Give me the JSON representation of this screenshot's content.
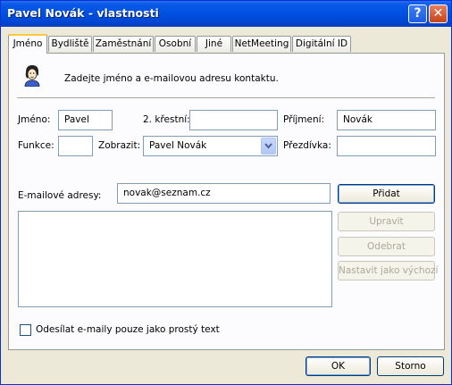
{
  "window": {
    "title": "Pavel Novák - vlastnosti",
    "help_icon": "?",
    "close_icon": "✕"
  },
  "tabs": [
    {
      "label": "Jméno",
      "active": true
    },
    {
      "label": "Bydliště",
      "active": false
    },
    {
      "label": "Zaměstnání",
      "active": false
    },
    {
      "label": "Osobní",
      "active": false
    },
    {
      "label": "Jiné",
      "active": false
    },
    {
      "label": "NetMeeting",
      "active": false
    },
    {
      "label": "Digitální ID",
      "active": false
    }
  ],
  "header": {
    "icon": "contact-person-icon",
    "text": "Zadejte jméno a e-mailovou adresu kontaktu."
  },
  "fields": {
    "first_name": {
      "label": "Jméno:",
      "value": "Pavel"
    },
    "middle_name": {
      "label": "2. křestní:",
      "value": ""
    },
    "last_name": {
      "label": "Příjmení:",
      "value": "Novák"
    },
    "title": {
      "label": "Funkce:",
      "value": ""
    },
    "display": {
      "label": "Zobrazit:",
      "value": "Pavel Novák"
    },
    "nickname": {
      "label": "Přezdívka:",
      "value": ""
    },
    "email": {
      "label": "E-mailové adresy:",
      "value": "novak@seznam.cz"
    }
  },
  "buttons": {
    "add": "Přidat",
    "edit": "Upravit",
    "remove": "Odebrat",
    "set_default": "Nastavit jako výchozí",
    "ok": "OK",
    "cancel": "Storno"
  },
  "plain_text_checkbox": {
    "label": "Odesílat e-maily pouze jako prostý text",
    "checked": false
  },
  "colors": {
    "titlebar": "#0054e3",
    "tab_highlight": "#ffc83c",
    "dialog_bg": "#ece9d8"
  }
}
